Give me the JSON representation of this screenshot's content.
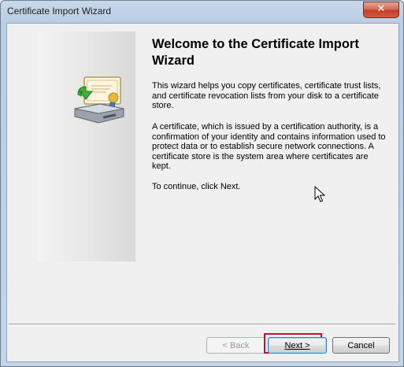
{
  "window": {
    "title": "Certificate Import Wizard",
    "close_symbol": "✕"
  },
  "content": {
    "heading": "Welcome to the Certificate Import Wizard",
    "paragraphs": [
      "This wizard helps you copy certificates, certificate trust lists, and certificate revocation lists from your disk to a certificate store.",
      "A certificate, which is issued by a certification authority, is a confirmation of your identity and contains information used to protect data or to establish secure network connections. A certificate store is the system area where certificates are kept.",
      "To continue, click Next."
    ]
  },
  "buttons": {
    "back": "< Back",
    "next": "Next >",
    "cancel": "Cancel"
  },
  "icons": {
    "wizard_graphic": "certificate-import-icon",
    "close": "close-icon",
    "cursor": "mouse-pointer-icon"
  },
  "colors": {
    "highlight": "#c8102e",
    "close_button": "#c0402a"
  }
}
